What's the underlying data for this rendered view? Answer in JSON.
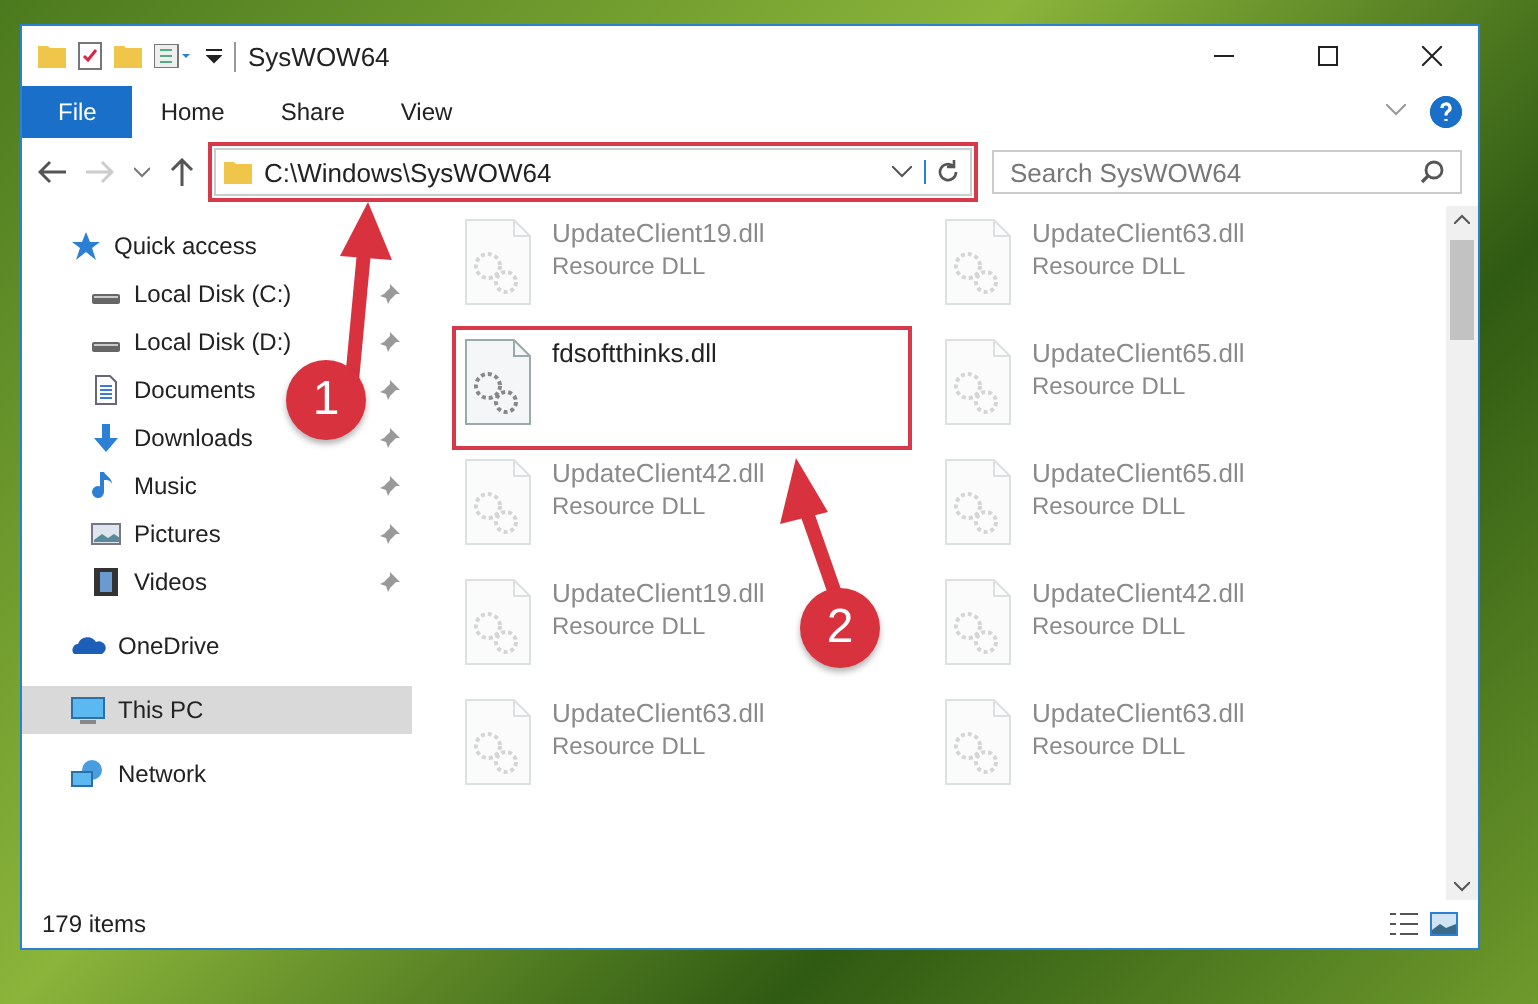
{
  "window": {
    "title": "SysWOW64"
  },
  "ribbon": {
    "tabs": [
      {
        "label": "File",
        "selected": true
      },
      {
        "label": "Home",
        "selected": false
      },
      {
        "label": "Share",
        "selected": false
      },
      {
        "label": "View",
        "selected": false
      }
    ]
  },
  "address_bar": {
    "path": "C:\\Windows\\SysWOW64",
    "highlighted": true
  },
  "search": {
    "placeholder": "Search SysWOW64"
  },
  "sidebar": {
    "items": [
      {
        "label": "Quick access",
        "kind": "star",
        "selected": false,
        "children": [
          {
            "label": "Local Disk (C:)",
            "kind": "drive",
            "pinned": true,
            "selected": false
          },
          {
            "label": "Local Disk (D:)",
            "kind": "drive",
            "pinned": true,
            "selected": false
          },
          {
            "label": "Documents",
            "kind": "document",
            "pinned": true,
            "selected": false
          },
          {
            "label": "Downloads",
            "kind": "download",
            "pinned": true,
            "selected": false
          },
          {
            "label": "Music",
            "kind": "music",
            "pinned": true,
            "selected": false
          },
          {
            "label": "Pictures",
            "kind": "picture",
            "pinned": true,
            "selected": false
          },
          {
            "label": "Videos",
            "kind": "video",
            "pinned": true,
            "selected": false
          }
        ]
      },
      {
        "label": "OneDrive",
        "kind": "cloud",
        "selected": false
      },
      {
        "label": "This PC",
        "kind": "computer",
        "selected": true
      },
      {
        "label": "Network",
        "kind": "network",
        "selected": false
      }
    ]
  },
  "files": [
    {
      "name": "UpdateClient19.dll",
      "type": "Resource DLL",
      "faded": true
    },
    {
      "name": "UpdateClient63.dll",
      "type": "Resource DLL",
      "faded": true
    },
    {
      "name": "fdsoftthinks.dll",
      "faded": false,
      "highlighted": true
    },
    {
      "name": "UpdateClient65.dll",
      "type": "Resource DLL",
      "faded": true
    },
    {
      "name": "UpdateClient42.dll",
      "type": "Resource DLL",
      "faded": true
    },
    {
      "name": "UpdateClient65.dll",
      "type": "Resource DLL",
      "faded": true
    },
    {
      "name": "UpdateClient19.dll",
      "type": "Resource DLL",
      "faded": true
    },
    {
      "name": "UpdateClient42.dll",
      "type": "Resource DLL",
      "faded": true
    },
    {
      "name": "UpdateClient63.dll",
      "type": "Resource DLL",
      "faded": true
    },
    {
      "name": "UpdateClient63.dll",
      "type": "Resource DLL",
      "faded": true
    }
  ],
  "status_bar": {
    "item_count": "179 items"
  },
  "annotations": [
    {
      "number": "1"
    },
    {
      "number": "2"
    }
  ]
}
